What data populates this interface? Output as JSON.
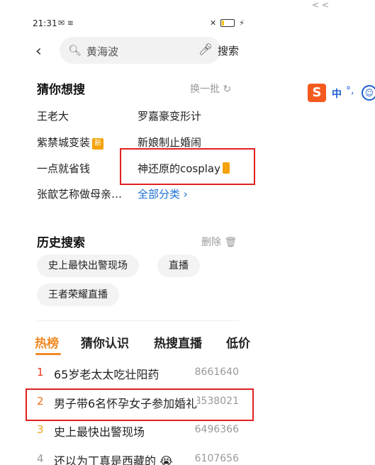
{
  "status": {
    "time": "21:31",
    "left_icons": "✉ ≋",
    "right_icons": "✕ ⚡",
    "battery_level": 0.2
  },
  "search": {
    "back_label": "‹",
    "value": "黄海波",
    "button_label": "搜索"
  },
  "guess": {
    "title": "猜你想搜",
    "refresh_label": "换一批",
    "items": [
      {
        "text": "王老大"
      },
      {
        "text": "罗嘉豪变形计"
      },
      {
        "text": "紫禁城变装",
        "badge": "新"
      },
      {
        "text": "新娘制止婚闹"
      },
      {
        "text": "一点就省钱"
      },
      {
        "text": "神还原的cosplay"
      },
      {
        "text": "张歆艺称做母亲…"
      }
    ],
    "all_categories": "全部分类 ›"
  },
  "history": {
    "title": "历史搜索",
    "delete_label": "删除",
    "chips": [
      "史上最快出警现场",
      "直播",
      "王者荣耀直播"
    ]
  },
  "tabs": [
    "热榜",
    "猜你认识",
    "热搜直播",
    "低价"
  ],
  "ranking": [
    {
      "rank": "1",
      "title": "65岁老太太吃壮阳药",
      "count": "8661640",
      "color": "#e8341c"
    },
    {
      "rank": "2",
      "title": "男子带6名怀孕女子参加婚礼",
      "count": "8538021",
      "color": "#f07020"
    },
    {
      "rank": "3",
      "title": "史上最快出警现场",
      "count": "6496366",
      "color": "#f0a020"
    },
    {
      "rank": "4",
      "title": "还以为丁真是西藏的 😭",
      "count": "6107656",
      "color": "#999999"
    }
  ],
  "ime": {
    "logo": "S",
    "text": "中",
    "dots": "°,",
    "smile": "☺"
  },
  "accent_color": "#f08a24"
}
